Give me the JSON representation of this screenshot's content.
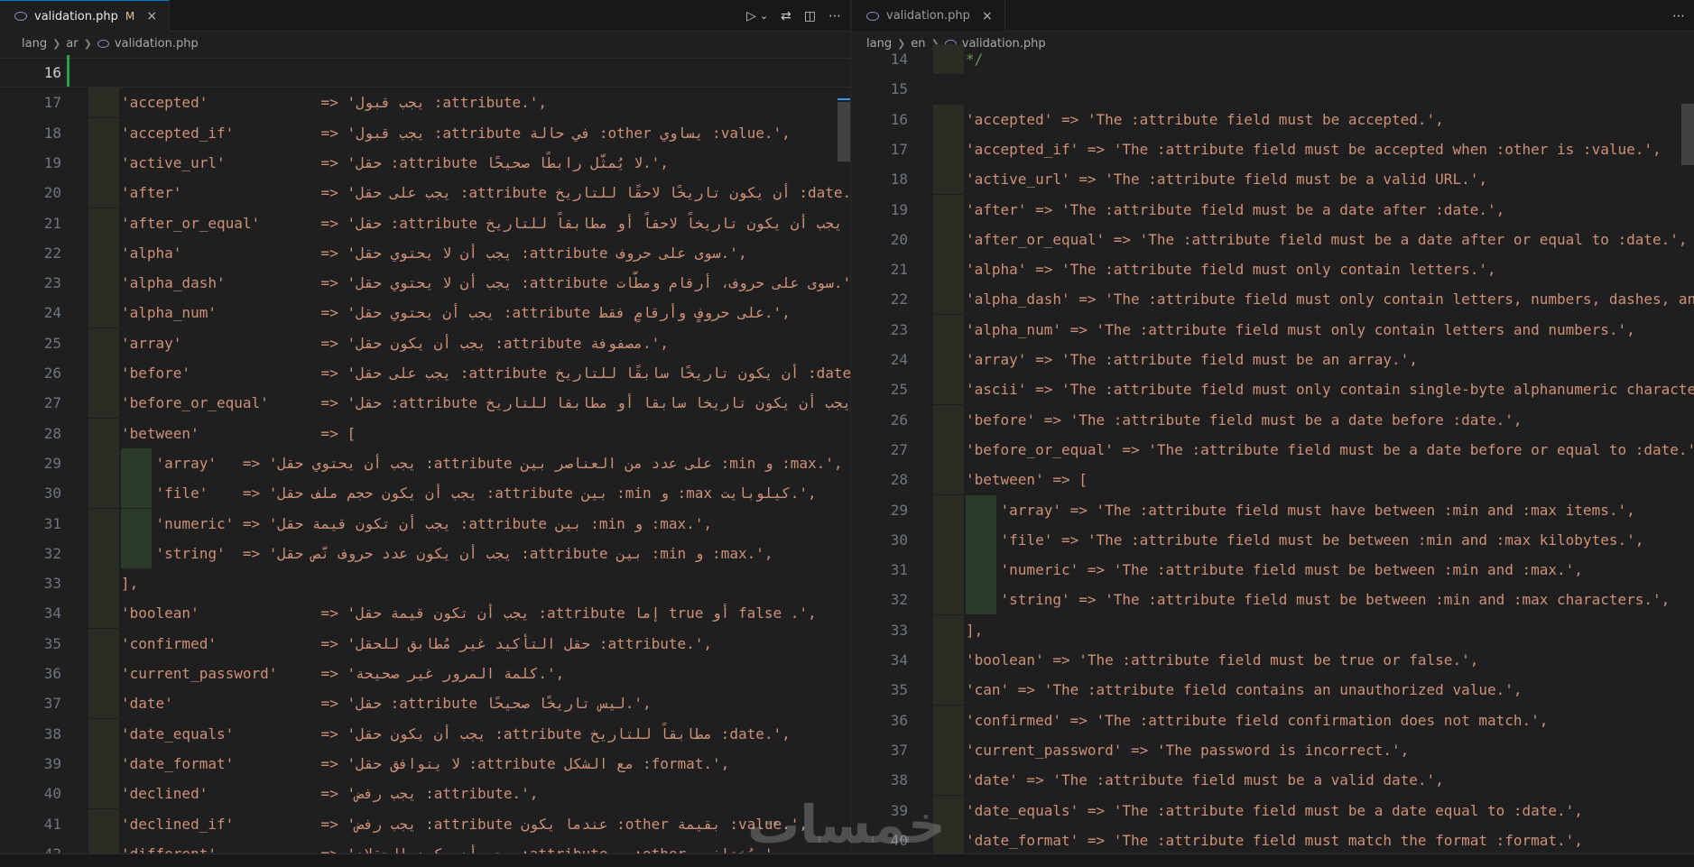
{
  "left": {
    "tab": {
      "filename": "validation.php",
      "modified_flag": "M",
      "close": "×"
    },
    "breadcrumb": [
      "lang",
      "ar",
      "validation.php"
    ],
    "lines": [
      {
        "n": "16",
        "code": ""
      },
      {
        "n": "17",
        "code": "'accepted'             => 'يجب قبول :attribute.',"
      },
      {
        "n": "18",
        "code": "'accepted_if'          => 'يجب قبول :attribute في حالة :other يساوي :value.',"
      },
      {
        "n": "19",
        "code": "'active_url'           => 'حقل :attribute لا يُمثّل رابطًا صحيحًا.',"
      },
      {
        "n": "20",
        "code": "'after'                => 'يجب على حقل :attribute أن يكون تاريخًا لاحقًا للتاريخ :date.',"
      },
      {
        "n": "21",
        "code": "'after_or_equal'       => 'حقل :attribute يجب أن يكون تاريخاً لاحقاً أو مطابقاً للتاريخ :date.',"
      },
      {
        "n": "22",
        "code": "'alpha'                => 'يجب أن لا يحتوي حقل :attribute سوى على حروف.',"
      },
      {
        "n": "23",
        "code": "'alpha_dash'           => 'يجب أن لا يحتوي حقل :attribute سوى على حروف، أرقام ومطّات.',"
      },
      {
        "n": "24",
        "code": "'alpha_num'            => 'يجب أن يحتوي حقل :attribute على حروفٍ وأرقامٍ فقط.',"
      },
      {
        "n": "25",
        "code": "'array'                => 'يجب أن يكون حقل :attribute ‏مصفوفة.',"
      },
      {
        "n": "26",
        "code": "'before'               => 'يجب على حقل :attribute أن يكون تاريخًا سابقًا للتاريخ :date.',"
      },
      {
        "n": "27",
        "code": "'before_or_equal'      => 'حقل :attribute يجب أن يكون تاريخا سابقا أو مطابقا للتاريخ :date.',"
      },
      {
        "n": "28",
        "code": "'between'              => ["
      },
      {
        "n": "29",
        "code": "    'array'   => 'يجب أن يحتوي حقل :attribute على عدد من العناصر بين :min و :max.',"
      },
      {
        "n": "30",
        "code": "    'file'    => 'يجب أن يكون حجم ملف حقل :attribute بين :min و :max كيلوبايت.',"
      },
      {
        "n": "31",
        "code": "    'numeric' => 'يجب أن تكون قيمة حقل :attribute بين :min و :max.',"
      },
      {
        "n": "32",
        "code": "    'string'  => 'يجب أن يكون عدد حروف نّص حقل :attribute بين :min و :max.',"
      },
      {
        "n": "33",
        "code": "],"
      },
      {
        "n": "34",
        "code": "'boolean'              => 'يجب أن تكون قيمة حقل :attribute إما true أو false .',"
      },
      {
        "n": "35",
        "code": "'confirmed'            => 'حقل التأكيد غير مُطابق للحقل :attribute.',"
      },
      {
        "n": "36",
        "code": "'current_password'     => 'كلمة المرور غير صحيحة.',"
      },
      {
        "n": "37",
        "code": "'date'                 => 'حقل :attribute ليس تاريخًا صحيحًا.',"
      },
      {
        "n": "38",
        "code": "'date_equals'          => 'يجب أن يكون حقل :attribute مطابقاً للتاريخ :date.',"
      },
      {
        "n": "39",
        "code": "'date_format'          => 'لا يتوافق حقل :attribute مع الشكل :format.',"
      },
      {
        "n": "40",
        "code": "'declined'             => 'يجب رفض :attribute.',"
      },
      {
        "n": "41",
        "code": "'declined_if'          => 'يجب رفض :attribute عندما يكون :other بقيمة :value.',"
      },
      {
        "n": "42",
        "code": "'different'            => 'يجب أن يكون الحقلان :attribute و :other مُختلفين.',"
      }
    ]
  },
  "right": {
    "tab": {
      "filename": "validation.php",
      "close": "×"
    },
    "breadcrumb": [
      "lang",
      "en",
      "validation.php"
    ],
    "lines": [
      {
        "n": "14",
        "code": "*/"
      },
      {
        "n": "15",
        "code": ""
      },
      {
        "n": "16",
        "code": "'accepted' => 'The :attribute field must be accepted.',"
      },
      {
        "n": "17",
        "code": "'accepted_if' => 'The :attribute field must be accepted when :other is :value.',"
      },
      {
        "n": "18",
        "code": "'active_url' => 'The :attribute field must be a valid URL.',"
      },
      {
        "n": "19",
        "code": "'after' => 'The :attribute field must be a date after :date.',"
      },
      {
        "n": "20",
        "code": "'after_or_equal' => 'The :attribute field must be a date after or equal to :date.',"
      },
      {
        "n": "21",
        "code": "'alpha' => 'The :attribute field must only contain letters.',"
      },
      {
        "n": "22",
        "code": "'alpha_dash' => 'The :attribute field must only contain letters, numbers, dashes, and und"
      },
      {
        "n": "23",
        "code": "'alpha_num' => 'The :attribute field must only contain letters and numbers.',"
      },
      {
        "n": "24",
        "code": "'array' => 'The :attribute field must be an array.',"
      },
      {
        "n": "25",
        "code": "'ascii' => 'The :attribute field must only contain single-byte alphanumeric characters an"
      },
      {
        "n": "26",
        "code": "'before' => 'The :attribute field must be a date before :date.',"
      },
      {
        "n": "27",
        "code": "'before_or_equal' => 'The :attribute field must be a date before or equal to :date.',"
      },
      {
        "n": "28",
        "code": "'between' => ["
      },
      {
        "n": "29",
        "code": "    'array' => 'The :attribute field must have between :min and :max items.',"
      },
      {
        "n": "30",
        "code": "    'file' => 'The :attribute field must be between :min and :max kilobytes.',"
      },
      {
        "n": "31",
        "code": "    'numeric' => 'The :attribute field must be between :min and :max.',"
      },
      {
        "n": "32",
        "code": "    'string' => 'The :attribute field must be between :min and :max characters.',"
      },
      {
        "n": "33",
        "code": "],"
      },
      {
        "n": "34",
        "code": "'boolean' => 'The :attribute field must be true or false.',"
      },
      {
        "n": "35",
        "code": "'can' => 'The :attribute field contains an unauthorized value.',"
      },
      {
        "n": "36",
        "code": "'confirmed' => 'The :attribute field confirmation does not match.',"
      },
      {
        "n": "37",
        "code": "'current_password' => 'The password is incorrect.',"
      },
      {
        "n": "38",
        "code": "'date' => 'The :attribute field must be a valid date.',"
      },
      {
        "n": "39",
        "code": "'date_equals' => 'The :attribute field must be a date equal to :date.',"
      },
      {
        "n": "40",
        "code": "'date_format' => 'The :attribute field must match the format :format.',"
      }
    ]
  },
  "toolbar": {
    "run": "▷",
    "run_menu": "⌄",
    "compare": "⇄",
    "split": "◫",
    "more": "⋯",
    "more_right": "⋯"
  },
  "watermark": "خمسات",
  "colors": {
    "string": "#ce9178",
    "operator": "#d4d4d4",
    "gutter_added": "#2ea043",
    "bracket": "#da70d6"
  }
}
